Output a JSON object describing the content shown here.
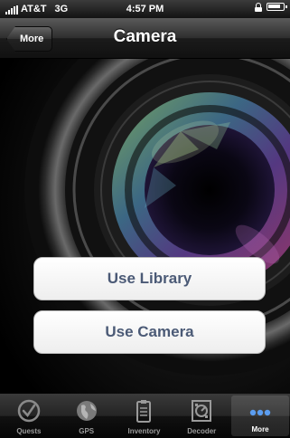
{
  "status_bar": {
    "carrier": "AT&T",
    "network": "3G",
    "time": "4:57 PM"
  },
  "nav_bar": {
    "back_label": "More",
    "title": "Camera"
  },
  "actions": {
    "use_library": "Use Library",
    "use_camera": "Use Camera"
  },
  "tab_bar": {
    "items": [
      {
        "label": "Quests",
        "icon": "checkmark-circle-icon"
      },
      {
        "label": "GPS",
        "icon": "globe-icon"
      },
      {
        "label": "Inventory",
        "icon": "clipboard-icon"
      },
      {
        "label": "Decoder",
        "icon": "decoder-icon"
      },
      {
        "label": "More",
        "icon": "more-dots-icon",
        "active": true
      }
    ]
  },
  "colors": {
    "button_text": "#4b5a76",
    "active_tab_icon": "#5b9df0"
  }
}
